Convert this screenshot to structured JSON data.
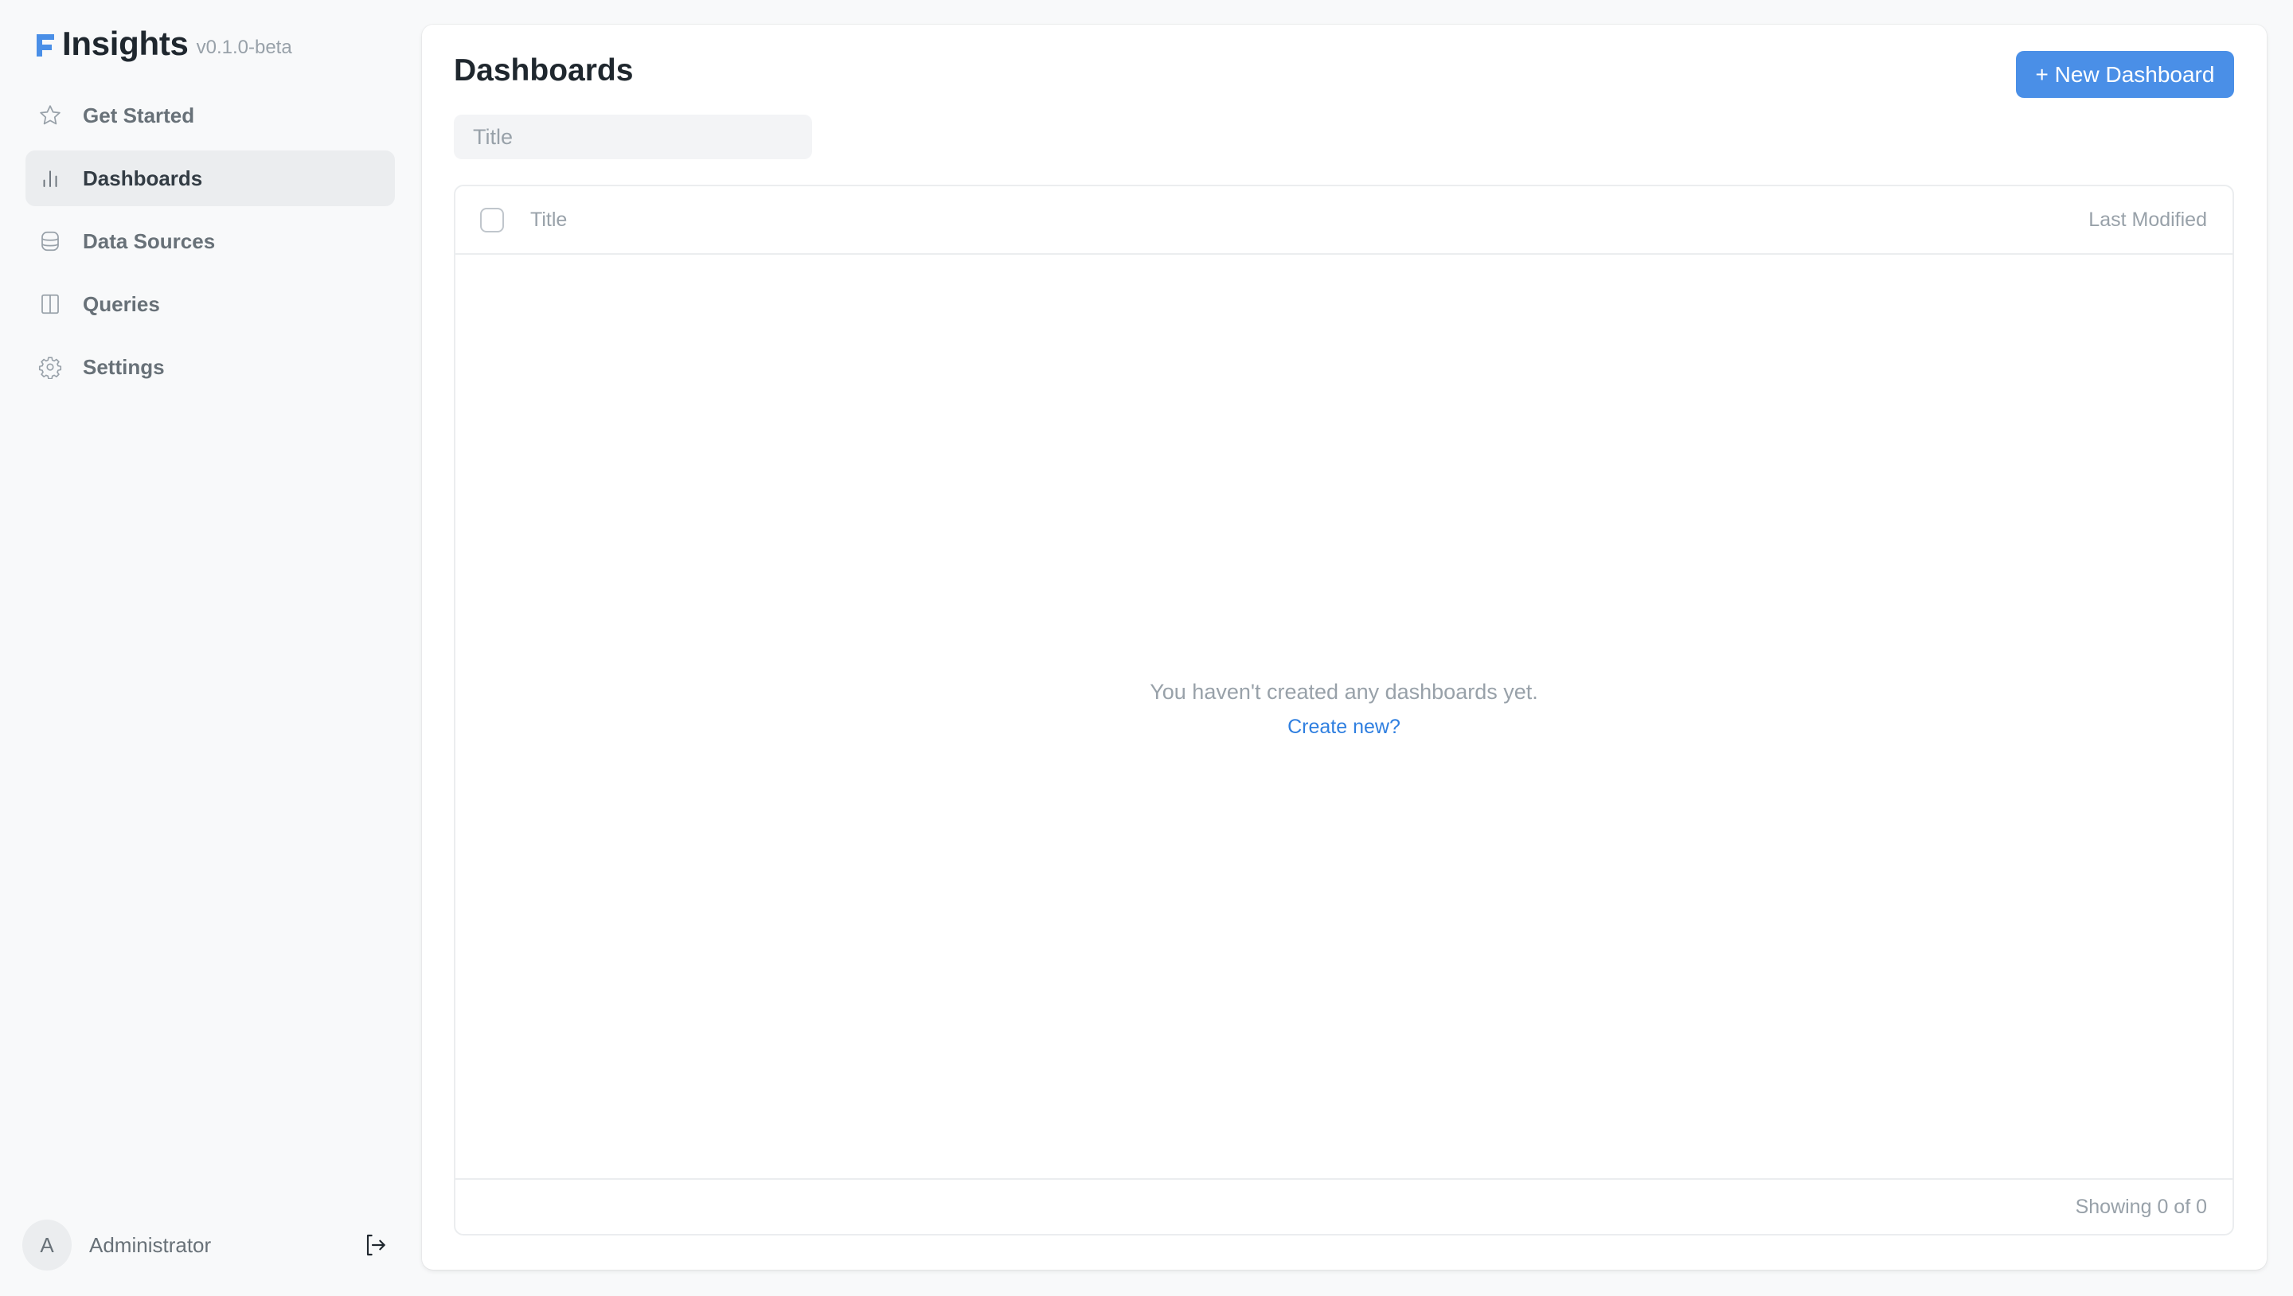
{
  "app": {
    "name": "Insights",
    "version": "v0.1.0-beta",
    "accent_color": "#4a8fe7"
  },
  "sidebar": {
    "items": [
      {
        "label": "Get Started",
        "icon": "star-icon",
        "active": false
      },
      {
        "label": "Dashboards",
        "icon": "bar-chart-icon",
        "active": true
      },
      {
        "label": "Data Sources",
        "icon": "database-icon",
        "active": false
      },
      {
        "label": "Queries",
        "icon": "columns-icon",
        "active": false
      },
      {
        "label": "Settings",
        "icon": "gear-icon",
        "active": false
      }
    ],
    "user": {
      "initial": "A",
      "name": "Administrator",
      "logout_icon": "logout-icon"
    }
  },
  "main": {
    "title": "Dashboards",
    "new_button_label": "+ New Dashboard",
    "search": {
      "placeholder": "Title",
      "value": ""
    },
    "table": {
      "columns": [
        "Title",
        "Last Modified"
      ],
      "rows": [],
      "empty_message": "You haven't created any dashboards yet.",
      "empty_link": "Create new?",
      "footer": "Showing 0 of 0"
    }
  }
}
